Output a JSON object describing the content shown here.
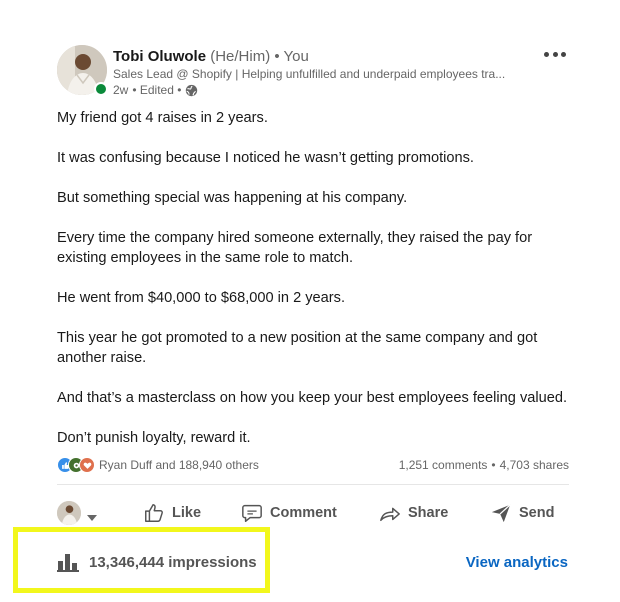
{
  "author": {
    "name": "Tobi Oluwole",
    "pronouns": "(He/Him)",
    "relation": "• You",
    "headline": "Sales Lead @ Shopify | Helping unfulfilled and underpaid employees tra...",
    "age": "2w",
    "edited": "• Edited •",
    "online_color": "#0a8a3a"
  },
  "post": {
    "paragraphs": [
      "My friend got 4 raises in 2 years.",
      "It was confusing because I noticed he wasn’t getting promotions.",
      "But something special was happening at his company.",
      "Every time the company hired someone externally, they raised the pay for existing employees in the same role to match.",
      "He went from $40,000 to $68,000 in 2 years.",
      "This year he got promoted to a new position at the same company and got another raise.",
      "And that’s a masterclass on how you keep your best employees feeling valued.",
      "Don’t punish loyalty, reward it."
    ]
  },
  "social": {
    "reactions_text": "Ryan Duff and 188,940 others",
    "reaction_icons": [
      "like-icon",
      "celebrate-icon",
      "love-icon"
    ],
    "comments": "1,251 comments",
    "separator": "•",
    "shares": "4,703 shares"
  },
  "actions": {
    "like": "Like",
    "comment": "Comment",
    "share": "Share",
    "send": "Send"
  },
  "insights": {
    "impressions": "13,346,444 impressions",
    "view_analytics": "View analytics",
    "highlight_color": "#f2f71c",
    "link_color": "#0a66c2"
  }
}
